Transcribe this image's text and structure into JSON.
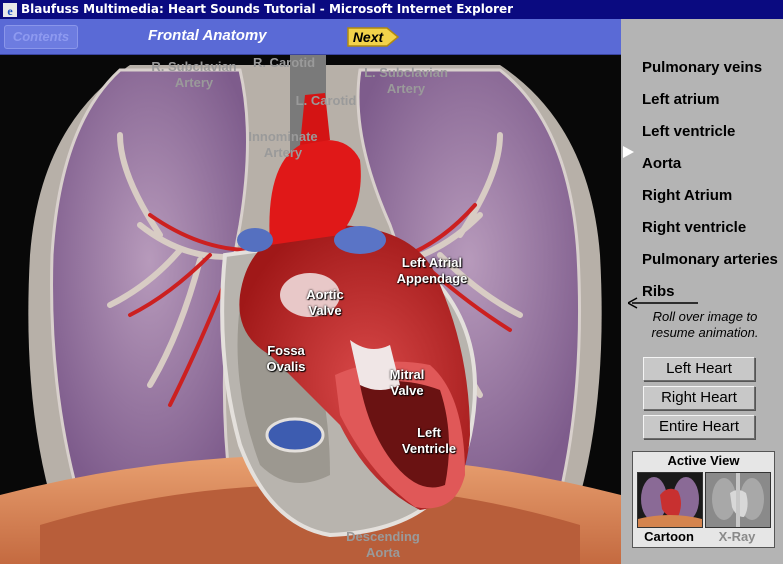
{
  "window": {
    "title": "Blaufuss Multimedia: Heart Sounds Tutorial - Microsoft Internet Explorer"
  },
  "header": {
    "contents_label": "Contents",
    "page_title": "Frontal Anatomy",
    "next_label": "Next"
  },
  "diagram_labels": {
    "r_subclavian": "R. Subclavian Artery",
    "r_carotid": "R. Carotid",
    "l_carotid": "L. Carotid",
    "l_subclavian": "L. Subclavian Artery",
    "innominate": "Innominate Artery",
    "left_atrial_appendage": "Left Atrial Appendage",
    "aortic_valve": "Aortic Valve",
    "fossa_ovalis": "Fossa Ovalis",
    "mitral_valve": "Mitral Valve",
    "left_ventricle": "Left Ventricle",
    "descending_aorta": "Descending Aorta"
  },
  "sidebar": {
    "items": [
      {
        "label": "Pulmonary veins"
      },
      {
        "label": "Left atrium"
      },
      {
        "label": "Left ventricle"
      },
      {
        "label": "Aorta"
      },
      {
        "label": "Right Atrium"
      },
      {
        "label": "Right ventricle"
      },
      {
        "label": "Pulmonary arteries"
      },
      {
        "label": "Ribs"
      }
    ],
    "selected": "Aorta",
    "hint": "Roll over image to resume animation.",
    "buttons": {
      "left_heart": "Left Heart",
      "right_heart": "Right Heart",
      "entire_heart": "Entire Heart"
    },
    "active_view": {
      "title": "Active View",
      "cartoon": "Cartoon",
      "xray": "X-Ray",
      "selected": "Cartoon"
    }
  },
  "colors": {
    "titlebar": "#0a0a80",
    "header": "#5a6ad6",
    "sidebar": "#b4b4b4",
    "next_button": "#f2d24a",
    "artery_red": "#e01818"
  }
}
